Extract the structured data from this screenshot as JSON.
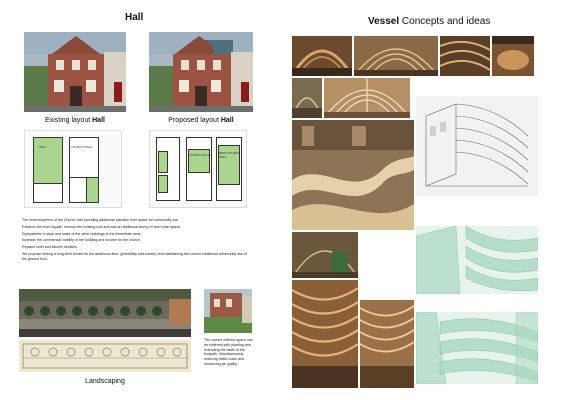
{
  "left": {
    "heading": "Hall",
    "existing_caption": "Existing layout",
    "proposed_caption": "Proposed layout",
    "caption_suffix": "Hall",
    "plan_labels": {
      "a": "HALL",
      "b": "KITCHEN",
      "c": "CHURCH HALL",
      "d": "NEW CHURCH HALL"
    },
    "description": [
      "The redevelopment of the Church Hall providing additional valuable floor space for community use.",
      "Enhance the front façade, remove the existing roof and add an additional storey of open plan space.",
      "Sympathetic in style and scale of the other buildings in the immediate area.",
      "Increase the commercial viability of the building and income for the church.",
      "Replace toilet and kitchen facilities.",
      "We propose finding a long-term tenant for the additional floor (potentially kids karate) and maintaining the current traditional community use of the ground floor."
    ],
    "landscaping_caption": "Landscaping",
    "street_note": "The current exterior space can be softened with planting and extending the width of the footpath. Simultaneously reducing traffic noise and enhancing air quality."
  },
  "right": {
    "heading_bold": "Vessel",
    "heading_rest": " Concepts and ideas"
  }
}
